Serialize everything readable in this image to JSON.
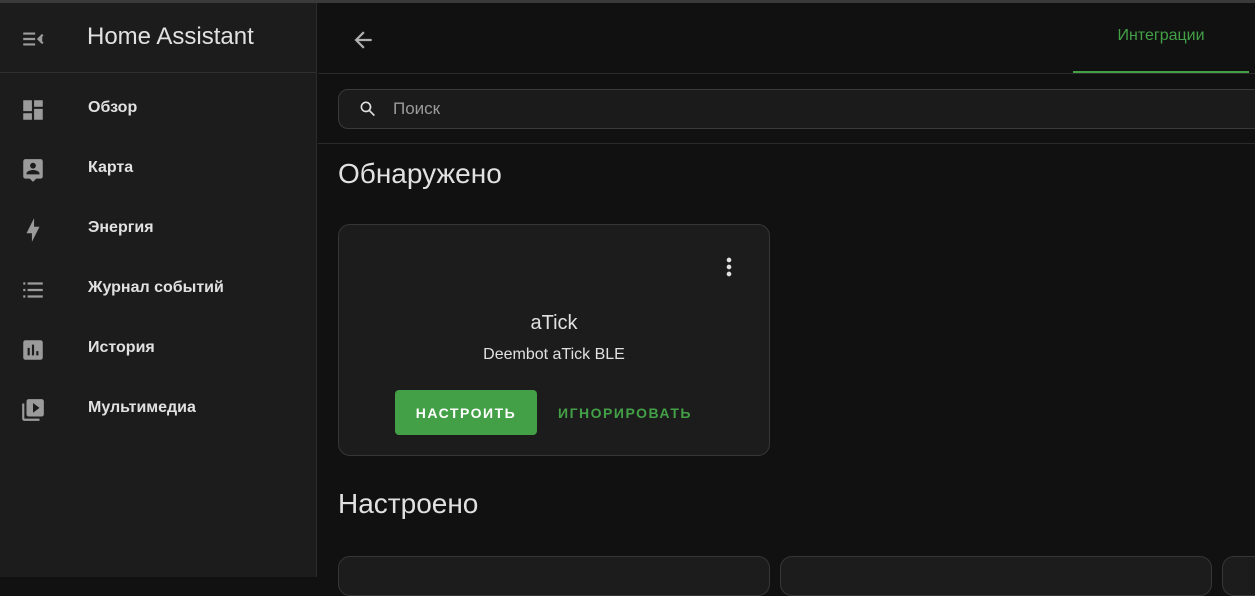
{
  "app": {
    "title": "Home Assistant"
  },
  "sidebar": {
    "items": [
      {
        "label": "Обзор",
        "icon": "dashboard-icon"
      },
      {
        "label": "Карта",
        "icon": "map-account-icon"
      },
      {
        "label": "Энергия",
        "icon": "lightning-bolt-icon"
      },
      {
        "label": "Журнал событий",
        "icon": "format-list-bulleted-icon"
      },
      {
        "label": "История",
        "icon": "chart-box-icon"
      },
      {
        "label": "Мультимедиа",
        "icon": "play-box-multiple-icon"
      }
    ]
  },
  "header": {
    "tab_label": "Интеграции"
  },
  "search": {
    "placeholder": "Поиск"
  },
  "discovered": {
    "title": "Обнаружено",
    "card": {
      "name": "aTick",
      "description": "Deembot aTick BLE",
      "configure_label": "НАСТРОИТЬ",
      "ignore_label": "ИГНОРИРОВАТЬ"
    }
  },
  "configured": {
    "title": "Настроено"
  },
  "colors": {
    "accent": "#43a047",
    "background": "#111111",
    "sidebar": "#1c1c1c",
    "card": "#1c1c1c",
    "text": "#e1e1e1"
  }
}
